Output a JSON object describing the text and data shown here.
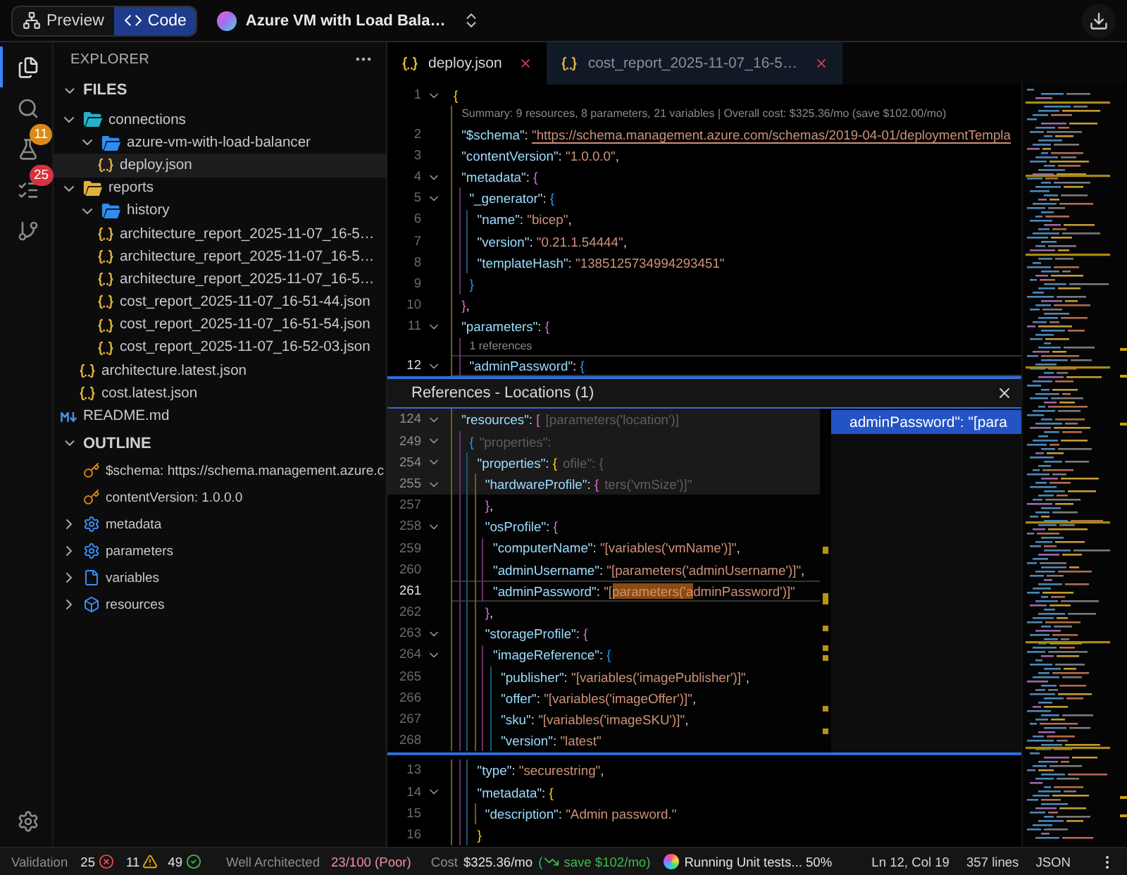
{
  "top_bar": {
    "view_toggle": [
      {
        "label": "Preview",
        "selected": false
      },
      {
        "label": "Code",
        "selected": true
      }
    ],
    "project_title": "Azure VM with Load Bala…"
  },
  "activity_bar": {
    "items": [
      {
        "selected": true
      },
      {
        "selected": false
      },
      {
        "selected": false,
        "badge": {
          "text": "11",
          "color": "#d98a17"
        }
      },
      {
        "selected": false,
        "badge": {
          "text": "25",
          "color": "#d6333f"
        }
      },
      {
        "selected": false
      }
    ]
  },
  "sidebar": {
    "title": "EXPLORER",
    "files": {
      "title": "FILES",
      "expanded": true,
      "items": [
        {
          "kind": "folder",
          "name": "connections",
          "color": "#24b1c7",
          "expanded": true,
          "selected": false,
          "children": [
            {
              "kind": "folder",
              "name": "azure-vm-with-load-balancer",
              "color": "#2f8cf0",
              "expanded": true,
              "selected": false,
              "children": [
                {
                  "kind": "json",
                  "name": "deploy.json",
                  "selected": true
                }
              ]
            }
          ]
        },
        {
          "kind": "folder",
          "name": "reports",
          "color": "#e2b23c",
          "expanded": true,
          "selected": false,
          "children": [
            {
              "kind": "folder",
              "name": "history",
              "color": "#2f8cf0",
              "expanded": true,
              "selected": false,
              "children": [
                {
                  "kind": "json",
                  "name": "architecture_report_2025-11-07_16-5…",
                  "selected": false
                },
                {
                  "kind": "json",
                  "name": "architecture_report_2025-11-07_16-5…",
                  "selected": false
                },
                {
                  "kind": "json",
                  "name": "architecture_report_2025-11-07_16-5…",
                  "selected": false
                },
                {
                  "kind": "json",
                  "name": "cost_report_2025-11-07_16-51-44.json",
                  "selected": false
                },
                {
                  "kind": "json",
                  "name": "cost_report_2025-11-07_16-51-54.json",
                  "selected": false
                },
                {
                  "kind": "json",
                  "name": "cost_report_2025-11-07_16-52-03.json",
                  "selected": false
                }
              ]
            },
            {
              "kind": "json",
              "name": "architecture.latest.json",
              "selected": false
            },
            {
              "kind": "json",
              "name": "cost.latest.json",
              "selected": false
            }
          ]
        },
        {
          "kind": "markdown",
          "name": "README.md",
          "selected": false
        }
      ]
    },
    "outline": {
      "title": "OUTLINE",
      "expanded": true,
      "items": [
        {
          "kind": "key",
          "label": "$schema: https://schema.management.azure.c"
        },
        {
          "kind": "key",
          "label": "contentVersion: 1.0.0.0"
        },
        {
          "kind": "module",
          "label": "metadata",
          "expanded": false
        },
        {
          "kind": "module",
          "label": "parameters",
          "expanded": false
        },
        {
          "kind": "variable",
          "label": "variables",
          "expanded": false
        },
        {
          "kind": "package",
          "label": "resources",
          "expanded": false
        }
      ]
    }
  },
  "editor": {
    "tabs": [
      {
        "label": "deploy.json",
        "selected": true
      },
      {
        "label": "cost_report_2025-11-07_16-5…",
        "selected": false
      }
    ],
    "lines": [
      {
        "number": "1",
        "foldable": true,
        "current": false,
        "tokens": [
          {
            "kind": "brace",
            "text": "{"
          }
        ],
        "children": [
          {
            "number": "2",
            "foldable": false,
            "current": false,
            "lens": "Summary: 9 resources, 8 parameters, 21 variables | Overall cost: $325.36/mo (save $102.00/mo)",
            "tokens": [
              {
                "kind": "key",
                "text": "\"$schema\""
              },
              {
                "kind": "punct",
                "text": ": "
              },
              {
                "kind": "link",
                "text": "\"https://schema.management.azure.com/schemas/2019-04-01/deploymentTempla"
              }
            ]
          },
          {
            "number": "3",
            "foldable": false,
            "current": false,
            "tokens": [
              {
                "kind": "key",
                "text": "\"contentVersion\""
              },
              {
                "kind": "punct",
                "text": ": "
              },
              {
                "kind": "string",
                "text": "\"1.0.0.0\""
              },
              {
                "kind": "punct",
                "text": ","
              }
            ]
          },
          {
            "number": "4",
            "foldable": true,
            "current": false,
            "tokens": [
              {
                "kind": "key",
                "text": "\"metadata\""
              },
              {
                "kind": "punct",
                "text": ": "
              },
              {
                "kind": "brace",
                "text": "{"
              }
            ],
            "children": [
              {
                "number": "5",
                "foldable": true,
                "current": false,
                "tokens": [
                  {
                    "kind": "key",
                    "text": "\"_generator\""
                  },
                  {
                    "kind": "punct",
                    "text": ": "
                  },
                  {
                    "kind": "brace",
                    "text": "{"
                  }
                ],
                "children": [
                  {
                    "number": "6",
                    "foldable": false,
                    "current": false,
                    "tokens": [
                      {
                        "kind": "key",
                        "text": "\"name\""
                      },
                      {
                        "kind": "punct",
                        "text": ": "
                      },
                      {
                        "kind": "string",
                        "text": "\"bicep\""
                      },
                      {
                        "kind": "punct",
                        "text": ","
                      }
                    ]
                  },
                  {
                    "number": "7",
                    "foldable": false,
                    "current": false,
                    "tokens": [
                      {
                        "kind": "key",
                        "text": "\"version\""
                      },
                      {
                        "kind": "punct",
                        "text": ": "
                      },
                      {
                        "kind": "string",
                        "text": "\"0.21.1.54444\""
                      },
                      {
                        "kind": "punct",
                        "text": ","
                      }
                    ]
                  },
                  {
                    "number": "8",
                    "foldable": false,
                    "current": false,
                    "tokens": [
                      {
                        "kind": "key",
                        "text": "\"templateHash\""
                      },
                      {
                        "kind": "punct",
                        "text": ": "
                      },
                      {
                        "kind": "string",
                        "text": "\"1385125734994293451\""
                      }
                    ]
                  }
                ]
              },
              {
                "number": "9",
                "foldable": false,
                "current": false,
                "tokens": [
                  {
                    "kind": "brace",
                    "text": "}"
                  }
                ]
              }
            ]
          },
          {
            "number": "10",
            "foldable": false,
            "current": false,
            "tokens": [
              {
                "kind": "brace",
                "text": "}"
              },
              {
                "kind": "punct",
                "text": ","
              }
            ]
          },
          {
            "number": "11",
            "foldable": true,
            "current": false,
            "tokens": [
              {
                "kind": "key",
                "text": "\"parameters\""
              },
              {
                "kind": "punct",
                "text": ": "
              },
              {
                "kind": "brace",
                "text": "{"
              }
            ],
            "children": [
              {
                "number": "12",
                "foldable": true,
                "current": true,
                "lens": "1 references",
                "tokens": [
                  {
                    "kind": "key",
                    "text": "\"adminPassword\""
                  },
                  {
                    "kind": "punct",
                    "text": ": "
                  },
                  {
                    "kind": "brace",
                    "text": "{"
                  }
                ],
                "children": [
                  {
                    "number": "13",
                    "foldable": false,
                    "current": false,
                    "tokens": [
                      {
                        "kind": "key",
                        "text": "\"type\""
                      },
                      {
                        "kind": "punct",
                        "text": ": "
                      },
                      {
                        "kind": "string",
                        "text": "\"securestring\""
                      },
                      {
                        "kind": "punct",
                        "text": ","
                      }
                    ]
                  },
                  {
                    "number": "14",
                    "foldable": true,
                    "current": false,
                    "tokens": [
                      {
                        "kind": "key",
                        "text": "\"metadata\""
                      },
                      {
                        "kind": "punct",
                        "text": ": "
                      },
                      {
                        "kind": "brace",
                        "text": "{"
                      }
                    ],
                    "children": [
                      {
                        "number": "15",
                        "foldable": false,
                        "current": false,
                        "tokens": [
                          {
                            "kind": "key",
                            "text": "\"description\""
                          },
                          {
                            "kind": "punct",
                            "text": ": "
                          },
                          {
                            "kind": "string",
                            "text": "\"Admin password.\""
                          }
                        ]
                      }
                    ]
                  },
                  {
                    "number": "16",
                    "foldable": false,
                    "current": false,
                    "tokens": [
                      {
                        "kind": "brace",
                        "text": "}"
                      }
                    ]
                  }
                ]
              }
            ]
          }
        ]
      }
    ],
    "peek": {
      "title": "References - Locations (1)",
      "sticky_lines": [
        {
          "number": "124",
          "foldable": true,
          "current": false,
          "tokens": [
            {
              "kind": "key",
              "text": "\"resources\""
            },
            {
              "kind": "punct",
              "text": ": "
            },
            {
              "kind": "brace",
              "text": "["
            },
            {
              "kind": "ghost",
              "text": "[parameters('location')]"
            }
          ],
          "children": [
            {
              "number": "249",
              "foldable": true,
              "current": false,
              "tokens": [
                {
                  "kind": "brace",
                  "text": "{"
                },
                {
                  "kind": "ghost",
                  "text": "\"properties\":"
                }
              ],
              "children": [
                {
                  "number": "254",
                  "foldable": true,
                  "current": false,
                  "tokens": [
                    {
                      "kind": "key",
                      "text": "\"properties\""
                    },
                    {
                      "kind": "punct",
                      "text": ": "
                    },
                    {
                      "kind": "brace",
                      "text": "{"
                    },
                    {
                      "kind": "ghost",
                      "text": "ofile\": {"
                    }
                  ],
                  "children": [
                    {
                      "number": "255",
                      "foldable": true,
                      "current": false,
                      "tokens": [
                        {
                          "kind": "key",
                          "text": "\"hardwareProfile\""
                        },
                        {
                          "kind": "punct",
                          "text": ": "
                        },
                        {
                          "kind": "brace",
                          "text": "{"
                        },
                        {
                          "kind": "ghost",
                          "text": "ters('vmSize')]\""
                        }
                      ]
                    }
                  ]
                }
              ]
            }
          ]
        }
      ],
      "lines": [
        {
          "number": "257",
          "foldable": false,
          "current": false,
          "tokens": [
            {
              "kind": "brace",
              "text": "}"
            },
            {
              "kind": "punct",
              "text": ","
            }
          ]
        },
        {
          "number": "258",
          "foldable": true,
          "current": false,
          "tokens": [
            {
              "kind": "key",
              "text": "\"osProfile\""
            },
            {
              "kind": "punct",
              "text": ": "
            },
            {
              "kind": "brace",
              "text": "{"
            }
          ],
          "children": [
            {
              "number": "259",
              "foldable": false,
              "current": false,
              "tokens": [
                {
                  "kind": "key",
                  "text": "\"computerName\""
                },
                {
                  "kind": "punct",
                  "text": ": "
                },
                {
                  "kind": "string",
                  "text": "\"[variables('vmName')]\""
                },
                {
                  "kind": "punct",
                  "text": ","
                }
              ]
            },
            {
              "number": "260",
              "foldable": false,
              "current": false,
              "tokens": [
                {
                  "kind": "key",
                  "text": "\"adminUsername\""
                },
                {
                  "kind": "punct",
                  "text": ": "
                },
                {
                  "kind": "string",
                  "text": "\"[parameters('adminUsername')]\""
                },
                {
                  "kind": "punct",
                  "text": ","
                }
              ]
            },
            {
              "number": "261",
              "foldable": false,
              "current": true,
              "tokens": [
                {
                  "kind": "key",
                  "text": "\"adminPassword\""
                },
                {
                  "kind": "punct",
                  "text": ": "
                },
                {
                  "kind": "string",
                  "text": "\"["
                },
                {
                  "kind": "match",
                  "text": "parameters('a"
                },
                {
                  "kind": "string",
                  "text": "dminPassword')]\""
                }
              ]
            }
          ]
        },
        {
          "number": "262",
          "foldable": false,
          "current": false,
          "tokens": [
            {
              "kind": "brace",
              "text": "}"
            },
            {
              "kind": "punct",
              "text": ","
            }
          ]
        },
        {
          "number": "263",
          "foldable": true,
          "current": false,
          "tokens": [
            {
              "kind": "key",
              "text": "\"storageProfile\""
            },
            {
              "kind": "punct",
              "text": ": "
            },
            {
              "kind": "brace",
              "text": "{"
            }
          ],
          "children": [
            {
              "number": "264",
              "foldable": true,
              "current": false,
              "tokens": [
                {
                  "kind": "key",
                  "text": "\"imageReference\""
                },
                {
                  "kind": "punct",
                  "text": ": "
                },
                {
                  "kind": "brace",
                  "text": "{"
                }
              ],
              "children": [
                {
                  "number": "265",
                  "foldable": false,
                  "current": false,
                  "tokens": [
                    {
                      "kind": "key",
                      "text": "\"publisher\""
                    },
                    {
                      "kind": "punct",
                      "text": ": "
                    },
                    {
                      "kind": "string",
                      "text": "\"[variables('imagePublisher')]\""
                    },
                    {
                      "kind": "punct",
                      "text": ","
                    }
                  ]
                },
                {
                  "number": "266",
                  "foldable": false,
                  "current": false,
                  "tokens": [
                    {
                      "kind": "key",
                      "text": "\"offer\""
                    },
                    {
                      "kind": "punct",
                      "text": ": "
                    },
                    {
                      "kind": "string",
                      "text": "\"[variables('imageOffer')]\""
                    },
                    {
                      "kind": "punct",
                      "text": ","
                    }
                  ]
                },
                {
                  "number": "267",
                  "foldable": false,
                  "current": false,
                  "tokens": [
                    {
                      "kind": "key",
                      "text": "\"sku\""
                    },
                    {
                      "kind": "punct",
                      "text": ": "
                    },
                    {
                      "kind": "string",
                      "text": "\"[variables('imageSKU')]\""
                    },
                    {
                      "kind": "punct",
                      "text": ","
                    }
                  ]
                },
                {
                  "number": "268",
                  "foldable": false,
                  "current": false,
                  "tokens": [
                    {
                      "kind": "key",
                      "text": "\"version\""
                    },
                    {
                      "kind": "punct",
                      "text": ": "
                    },
                    {
                      "kind": "string",
                      "text": "\"latest\""
                    }
                  ]
                }
              ]
            }
          ]
        }
      ],
      "results": [
        {
          "text": "adminPassword\": \"[para",
          "selected": true
        }
      ]
    }
  },
  "status_bar": {
    "validation": {
      "label": "Validation",
      "errors": "25",
      "warnings": "11",
      "passed": "49"
    },
    "well_architected": {
      "label": "Well Architected",
      "score": "23/100 (Poor)"
    },
    "cost": {
      "label": "Cost",
      "amount": "$325.36/mo",
      "savings_prefix": "(",
      "savings": "save $102/mo)"
    },
    "task": "Running Unit tests... 50%",
    "cursor": "Ln 12, Col 19",
    "line_count": "357 lines",
    "language": "JSON"
  }
}
